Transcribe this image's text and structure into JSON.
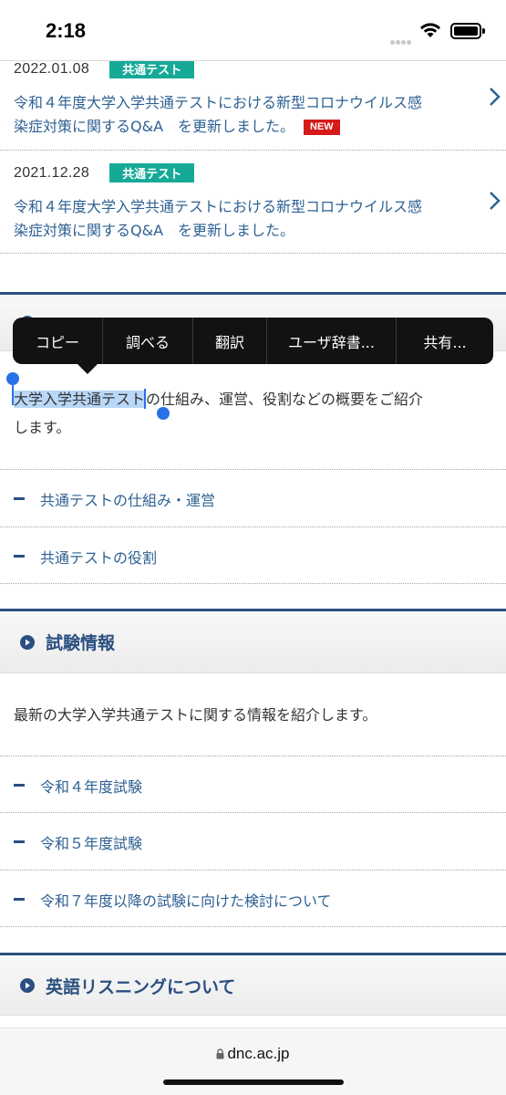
{
  "status_bar": {
    "time": "2:18"
  },
  "news": [
    {
      "date": "2022.01.08",
      "badge": "共通テスト",
      "line1": "令和４年度大学入学共通テストにおける新型コロナウイルス感",
      "line2": "染症対策に関するQ&A　を更新しました。",
      "new_label": "NEW"
    },
    {
      "date": "2021.12.28",
      "badge": "共通テスト",
      "line1": "令和４年度大学入学共通テストにおける新型コロナウイルス感",
      "line2": "染症対策に関するQ&A　を更新しました。"
    }
  ],
  "context_menu": {
    "items": [
      "コピー",
      "調べる",
      "翻訳",
      "ユーザ辞書...",
      "共有..."
    ]
  },
  "overview": {
    "selected_text": "大学入学共通テスト",
    "text_rest": "の仕組み、運営、役割などの概要をご紹介",
    "text_line2": "します。",
    "links": [
      "共通テストの仕組み・運営",
      "共通テストの役割"
    ]
  },
  "exam_info": {
    "title": "試験情報",
    "description": "最新の大学入学共通テストに関する情報を紹介します。",
    "links": [
      "令和４年度試験",
      "令和５年度試験",
      "令和７年度以降の試験に向けた検討について"
    ]
  },
  "listening": {
    "title": "英語リスニングについて"
  },
  "browser": {
    "url": "dnc.ac.jp"
  },
  "colors": {
    "accent": "#2b4f80",
    "link": "#2e6192",
    "badge": "#17a998",
    "new_badge": "#d61a1a",
    "selection": "#b9d7f7"
  }
}
